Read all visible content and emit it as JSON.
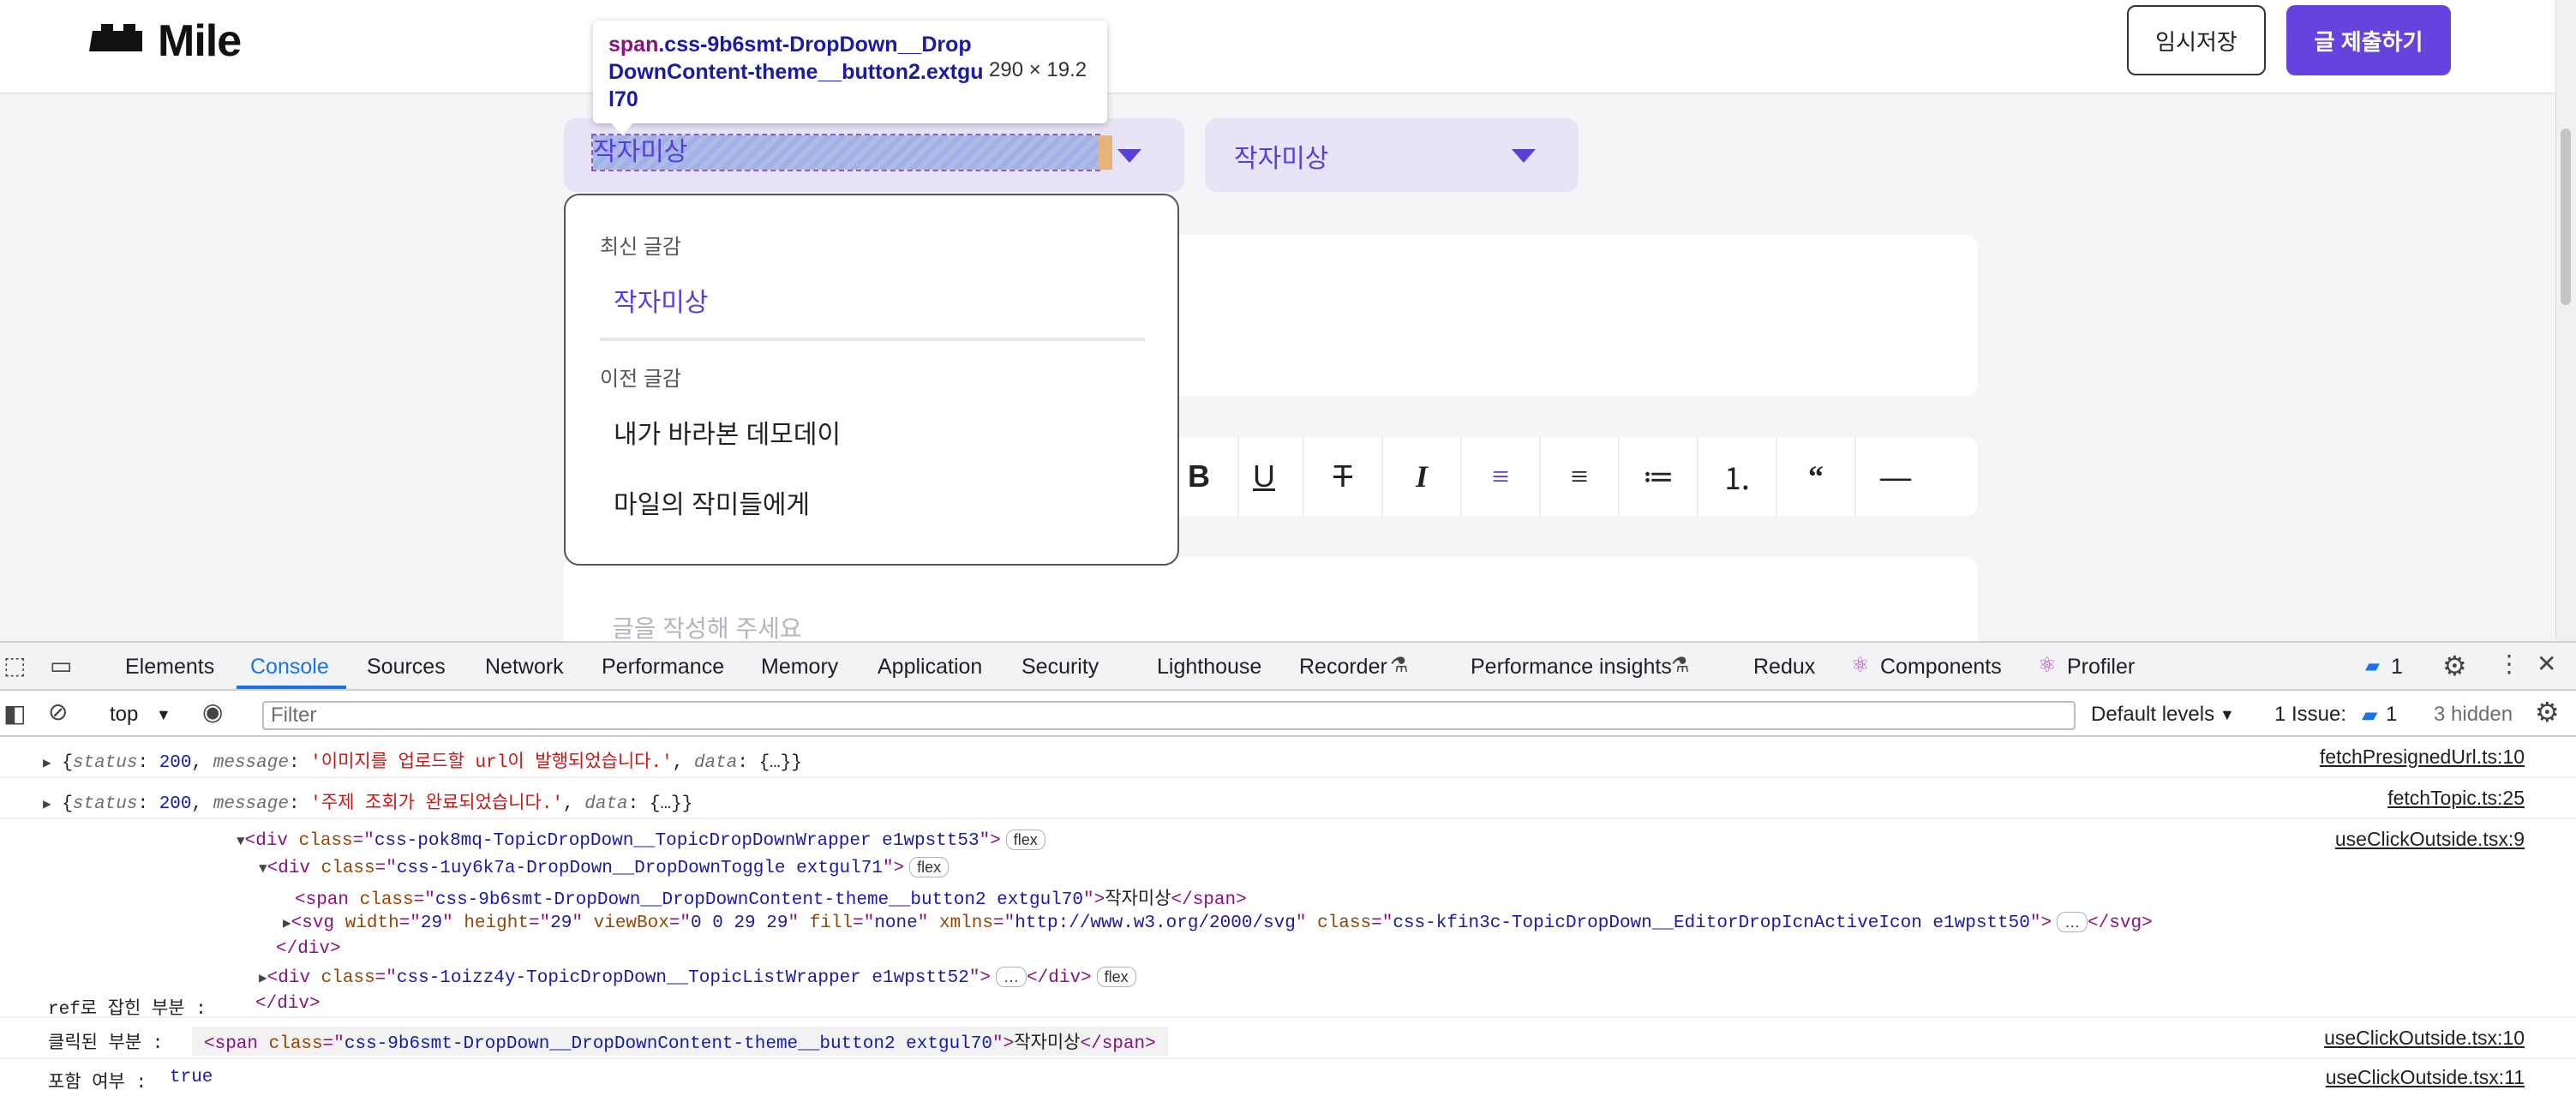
{
  "app": {
    "logo_text": "Mile",
    "save_label": "임시저장",
    "submit_label": "글 제출하기"
  },
  "inspector_tooltip": {
    "tag": "span",
    "selector": ".css-9b6smt-DropDown__DropDownContent-theme__button2.extgul70",
    "size": "290 × 19.2"
  },
  "dropdowns": {
    "topic_selected": "작자미상",
    "author_selected": "작자미상"
  },
  "topic_list": {
    "section_latest": "최신 글감",
    "latest_items": [
      "작자미상"
    ],
    "section_previous": "이전 글감",
    "previous_items": [
      "내가 바라본 데모데이",
      "마일의 작미들에게"
    ]
  },
  "toolbar": {
    "buttons": [
      "B",
      "U",
      "T",
      "I",
      "≡",
      "≡",
      "≔",
      "⒈",
      "“",
      "—"
    ]
  },
  "editor": {
    "placeholder": "글을 작성해 주세요"
  },
  "devtools": {
    "tabs": [
      "Elements",
      "Console",
      "Sources",
      "Network",
      "Performance",
      "Memory",
      "Application",
      "Security",
      "Lighthouse",
      "Recorder",
      "Performance insights",
      "Redux",
      "Components",
      "Profiler"
    ],
    "active_tab": "Console",
    "issues_badge": "1",
    "context": "top",
    "filter_placeholder": "Filter",
    "levels": "Default levels",
    "issue_label": "1 Issue:",
    "issue_count": "1",
    "hidden_label": "3 hidden",
    "logs": [
      {
        "status_key": "status",
        "status_val": "200",
        "message_key": "message",
        "message": "'이미지를 업로드할 url이 발행되었습니다.'",
        "data_key": "data",
        "data": "{…}",
        "source": "fetchPresignedUrl.ts:10"
      },
      {
        "status_key": "status",
        "status_val": "200",
        "message_key": "message",
        "message": "'주제 조회가 완료되었습니다.'",
        "data_key": "data",
        "data": "{…}",
        "source": "fetchTopic.ts:25"
      }
    ],
    "dom_log": {
      "source": "useClickOutside.tsx:9",
      "label": "ref로 잡힌 부분 :",
      "wrapper_class": "css-pok8mq-TopicDropDown__TopicDropDownWrapper e1wpstt53",
      "toggle_class": "css-1uy6k7a-DropDown__DropDownToggle extgul71",
      "span_class": "css-9b6smt-DropDown__DropDownContent-theme__button2 extgul70",
      "span_text": "작자미상",
      "svg_width": "29",
      "svg_height": "29",
      "svg_viewbox": "0 0 29 29",
      "svg_fill": "none",
      "svg_xmlns": "http://www.w3.org/2000/svg",
      "svg_class": "css-kfin3c-TopicDropDown__EditorDropIcnActiveIcon e1wpstt50",
      "list_class": "css-1oizz4y-TopicDropDown__TopicListWrapper e1wpstt52",
      "flex_badge": "flex"
    },
    "clicked_log": {
      "label": "클릭된 부분 :",
      "span_class": "css-9b6smt-DropDown__DropDownContent-theme__button2 extgul70",
      "span_text": "작자미상",
      "source": "useClickOutside.tsx:10"
    },
    "contains_log": {
      "label": "포함 여부 :",
      "value": "true",
      "source": "useClickOutside.tsx:11"
    }
  }
}
